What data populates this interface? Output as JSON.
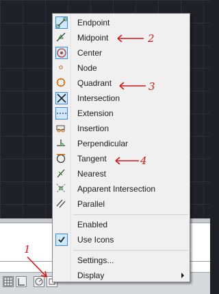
{
  "menu": {
    "items": [
      {
        "label": "Endpoint",
        "icon": "endpoint-snap-icon",
        "checked": true
      },
      {
        "label": "Midpoint",
        "icon": "midpoint-snap-icon",
        "checked": false
      },
      {
        "label": "Center",
        "icon": "center-snap-icon",
        "checked": true
      },
      {
        "label": "Node",
        "icon": "node-snap-icon",
        "checked": false
      },
      {
        "label": "Quadrant",
        "icon": "quadrant-snap-icon",
        "checked": false
      },
      {
        "label": "Intersection",
        "icon": "intersection-snap-icon",
        "checked": true
      },
      {
        "label": "Extension",
        "icon": "extension-snap-icon",
        "checked": true
      },
      {
        "label": "Insertion",
        "icon": "insertion-snap-icon",
        "checked": false
      },
      {
        "label": "Perpendicular",
        "icon": "perpendicular-snap-icon",
        "checked": false
      },
      {
        "label": "Tangent",
        "icon": "tangent-snap-icon",
        "checked": false
      },
      {
        "label": "Nearest",
        "icon": "nearest-snap-icon",
        "checked": false
      },
      {
        "label": "Apparent Intersection",
        "icon": "apparent-intersection-snap-icon",
        "checked": false
      },
      {
        "label": "Parallel",
        "icon": "parallel-snap-icon",
        "checked": false
      }
    ],
    "toggles": [
      {
        "label": "Enabled",
        "checked": false
      },
      {
        "label": "Use Icons",
        "checked": true
      }
    ],
    "footer": [
      {
        "label": "Settings..."
      },
      {
        "label": "Display",
        "has_submenu": true
      }
    ]
  },
  "annotations": {
    "a1": "1",
    "a2": "2",
    "a3": "3",
    "a4": "4",
    "color": "#d01818"
  },
  "colors": {
    "checked_icon_bg": "#cfe8fb",
    "checked_icon_border": "#3c8ad7",
    "canvas": "#1f2128",
    "menu_bg": "#f0f0f0"
  }
}
